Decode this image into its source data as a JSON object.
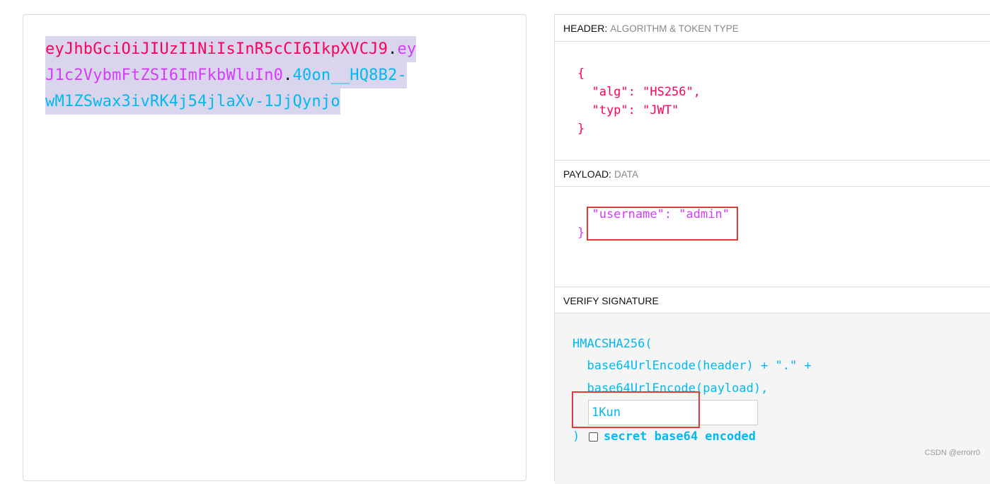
{
  "encoded": {
    "line1": {
      "header": "eyJhbGciOiJIUzI1NiIsInR5cCI6IkpXVCJ9",
      "dot": ".",
      "payload": "ey"
    },
    "line2": {
      "payload": "J1c2VybmFtZSI6ImFkbWluIn0",
      "dot": ".",
      "sig": "40on__HQ8B2-"
    },
    "line3": {
      "sig": "wM1ZSwax3ivRK4j54jlaXv-1JjQynjo"
    }
  },
  "header_section": {
    "title": "HEADER:",
    "subtitle": "ALGORITHM & TOKEN TYPE",
    "lines": [
      "{",
      "  \"alg\": \"HS256\",",
      "  \"typ\": \"JWT\"",
      "}"
    ]
  },
  "payload_section": {
    "title": "PAYLOAD:",
    "subtitle": "DATA",
    "lines": [
      "  \"username\": \"admin\"",
      "}"
    ]
  },
  "verify_section": {
    "title": "VERIFY SIGNATURE",
    "lines": [
      "HMACSHA256(",
      "  base64UrlEncode(header) + \".\" +",
      "  base64UrlEncode(payload),"
    ],
    "secret_value": "1Kun",
    "close_paren": ")",
    "checkbox_label": "secret base64 encoded",
    "checkbox_checked": false
  },
  "colors": {
    "header": "#fb015b",
    "payload": "#d63aff",
    "signature": "#00b9f1",
    "highlight": "#e53935"
  },
  "watermark": "CSDN @errorr0"
}
